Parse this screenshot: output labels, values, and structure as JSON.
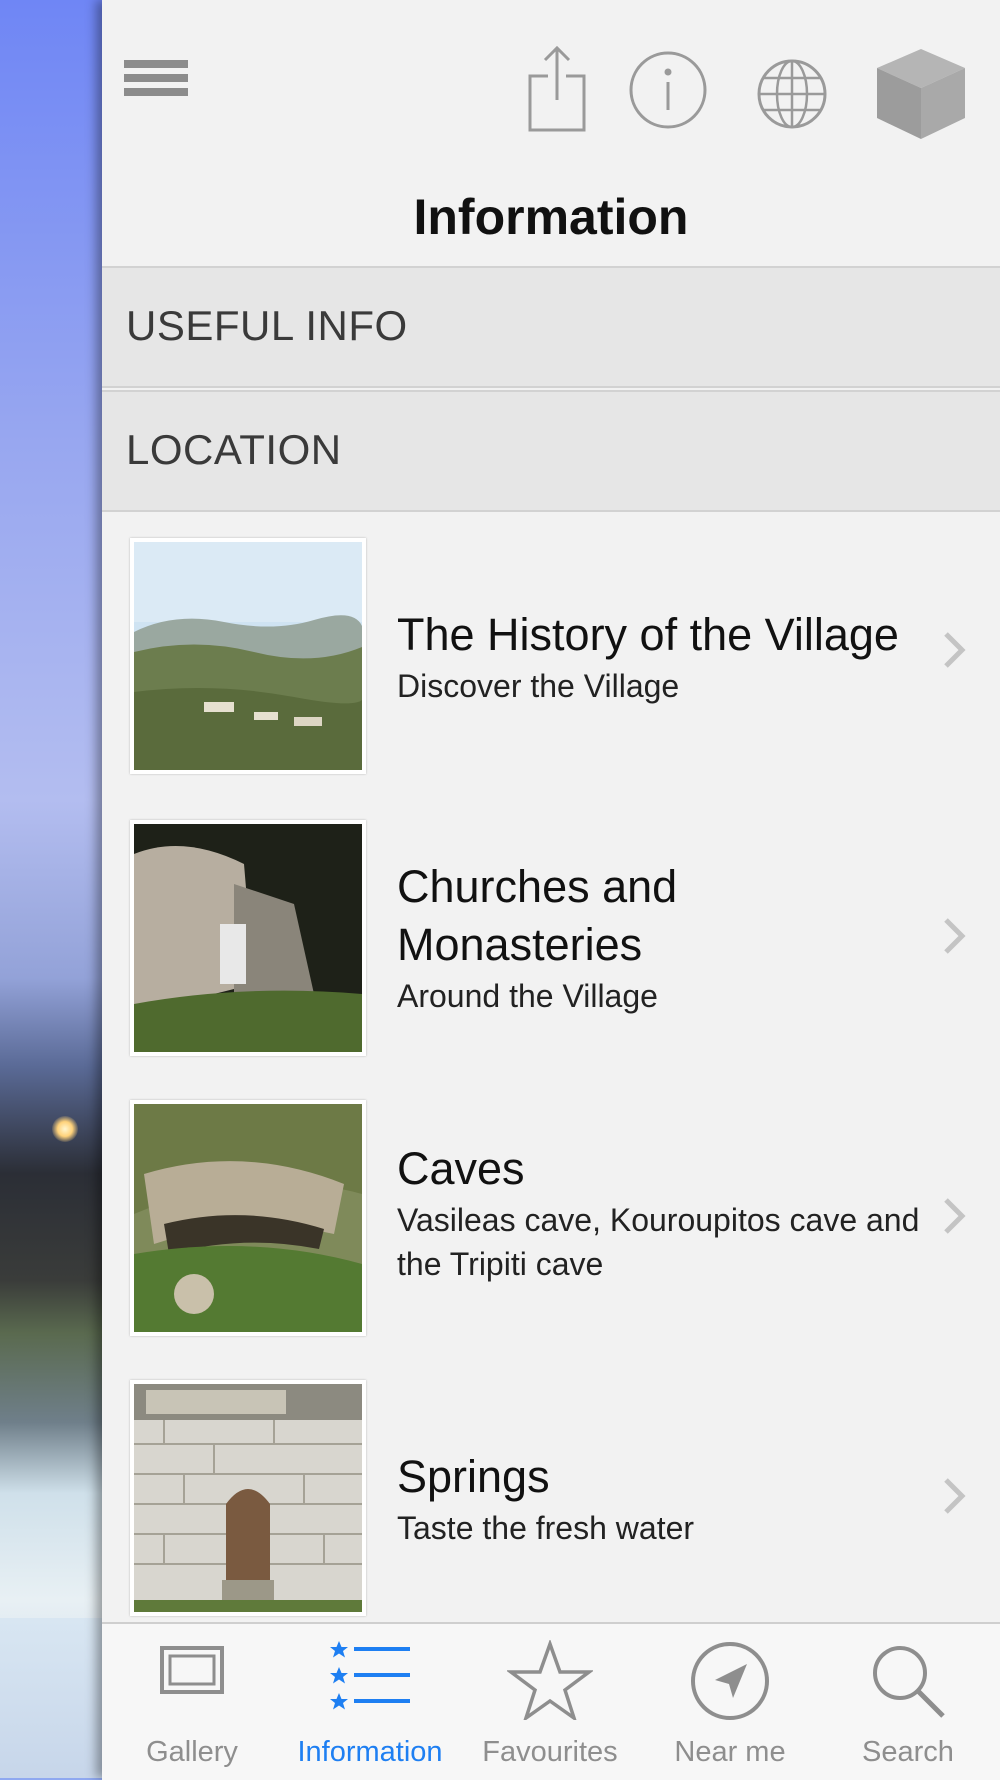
{
  "header": {
    "title": "Information",
    "icons": [
      "menu-icon",
      "share-icon",
      "info-icon",
      "globe-icon",
      "cube-icon"
    ]
  },
  "sections": [
    {
      "label": "USEFUL INFO"
    },
    {
      "label": "LOCATION"
    }
  ],
  "items": [
    {
      "title": "The History of the Village",
      "subtitle": "Discover the Village"
    },
    {
      "title": "Churches and Monasteries",
      "subtitle": "Around the Village"
    },
    {
      "title": "Caves",
      "subtitle": "Vasileas cave, Kouroupitos cave and the Tripiti cave"
    },
    {
      "title": "Springs",
      "subtitle": "Taste the fresh water"
    }
  ],
  "tabs": [
    {
      "label": "Gallery",
      "icon": "gallery-icon",
      "active": false
    },
    {
      "label": "Information",
      "icon": "list-icon",
      "active": true
    },
    {
      "label": "Favourites",
      "icon": "star-icon",
      "active": false
    },
    {
      "label": "Near me",
      "icon": "compass-icon",
      "active": false
    },
    {
      "label": "Search",
      "icon": "search-icon",
      "active": false
    }
  ],
  "colors": {
    "accent": "#1e7ff2",
    "panel": "#f2f2f2",
    "section": "#e6e6e6",
    "icon_gray": "#8c8c8c"
  }
}
